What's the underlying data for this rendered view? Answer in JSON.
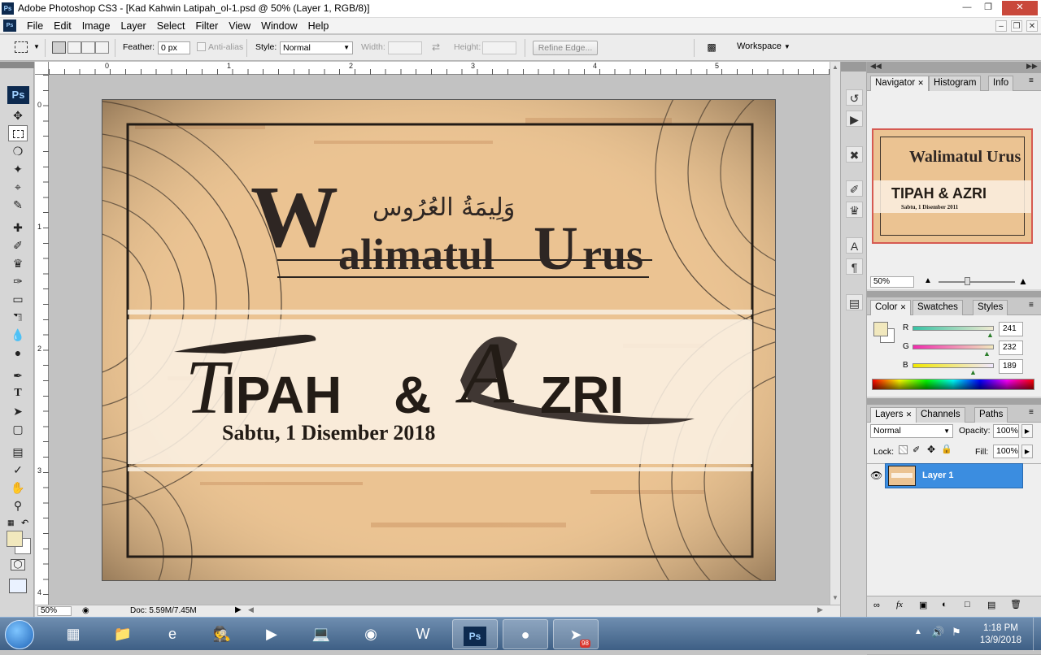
{
  "window": {
    "app_icon": "Ps",
    "title": "Adobe Photoshop CS3 - [Kad Kahwin Latipah_ol-1.psd @ 50% (Layer 1, RGB/8)]",
    "controls": [
      "minimize-icon",
      "maximize-icon",
      "close-icon"
    ]
  },
  "menubar": {
    "items": [
      "File",
      "Edit",
      "Image",
      "Layer",
      "Select",
      "Filter",
      "View",
      "Window",
      "Help"
    ]
  },
  "options_bar": {
    "feather_label": "Feather:",
    "feather_value": "0 px",
    "antialias_label": "Anti-alias",
    "style_label": "Style:",
    "style_value": "Normal",
    "width_label": "Width:",
    "height_label": "Height:",
    "refine_edge_label": "Refine Edge...",
    "workspace_label": "Workspace"
  },
  "toolbox": {
    "logo": "Ps",
    "tools": [
      "move-tool",
      "rectangular-marquee-tool",
      "lasso-tool",
      "magic-wand-tool",
      "crop-tool",
      "slice-tool",
      "healing-brush-tool",
      "brush-tool",
      "clone-stamp-tool",
      "history-brush-tool",
      "eraser-tool",
      "paint-bucket-tool",
      "blur-tool",
      "dodge-tool",
      "pen-tool",
      "type-tool",
      "path-selection-tool",
      "rectangle-tool",
      "notes-tool",
      "eyedropper-tool",
      "hand-tool",
      "zoom-tool"
    ],
    "foreground_color": "#f1e8bd",
    "background_color": "#ffffff"
  },
  "document": {
    "ruler_top_numbers": [
      "0",
      "1",
      "2",
      "3",
      "4",
      "5"
    ],
    "ruler_left_numbers": [
      "0",
      "1",
      "2",
      "3",
      "4"
    ],
    "zoom": "50%",
    "doc_size": "Doc: 5.59M/7.45M",
    "artwork": {
      "heading": "Walimatul Urus",
      "heading_first": "W",
      "heading_mid": "alimatul",
      "heading_cap2": "U",
      "heading_end": "rus",
      "arabic": "وَلِيمَةُ العُرُوس",
      "names_a_cap": "T",
      "names_a": "IPAH",
      "ampersand": "&",
      "names_b_cap": "A",
      "names_b": "ZRI",
      "date": "Sabtu, 1 Disember 2018"
    }
  },
  "navigator_panel": {
    "tabs": [
      "Navigator",
      "Histogram",
      "Info"
    ],
    "active_tab": "Navigator",
    "zoom_value": "50%",
    "thumb_heading": "Walimatul Urus",
    "thumb_names": "TIPAH & AZRI",
    "thumb_date": "Sabtu, 1 Disember 2011"
  },
  "color_panel": {
    "tabs": [
      "Color",
      "Swatches",
      "Styles"
    ],
    "active_tab": "Color",
    "channels": [
      {
        "label": "R",
        "value": "241",
        "level": 241,
        "track": "linear-gradient(90deg,#38c2a4,#f0ead0)"
      },
      {
        "label": "G",
        "value": "232",
        "level": 232,
        "track": "linear-gradient(90deg,#f12bad,#f1e8bd)"
      },
      {
        "label": "B",
        "value": "189",
        "level": 189,
        "track": "linear-gradient(90deg,#f1e800,#f1e8ff)"
      }
    ],
    "current_color": "#f1e8bd"
  },
  "layers_panel": {
    "tabs": [
      "Layers",
      "Channels",
      "Paths"
    ],
    "active_tab": "Layers",
    "blend_mode": "Normal",
    "opacity_label": "Opacity:",
    "opacity_value": "100%",
    "lock_label": "Lock:",
    "fill_label": "Fill:",
    "fill_value": "100%",
    "layers": [
      {
        "name": "Layer 1",
        "visible": true,
        "selected": true
      }
    ]
  },
  "taskbar": {
    "apps": [
      "start-orb-icon",
      "apps-grid-icon",
      "file-explorer-icon",
      "internet-explorer-icon",
      "spy-tool-icon",
      "media-player-icon",
      "network-icon",
      "chrome-icon",
      "word-icon",
      "photoshop-icon",
      "firefox-icon",
      "telegram-icon"
    ],
    "photoshop_label": "Ps",
    "telegram_badge": "98",
    "time": "1:18 PM",
    "date": "13/9/2018"
  }
}
